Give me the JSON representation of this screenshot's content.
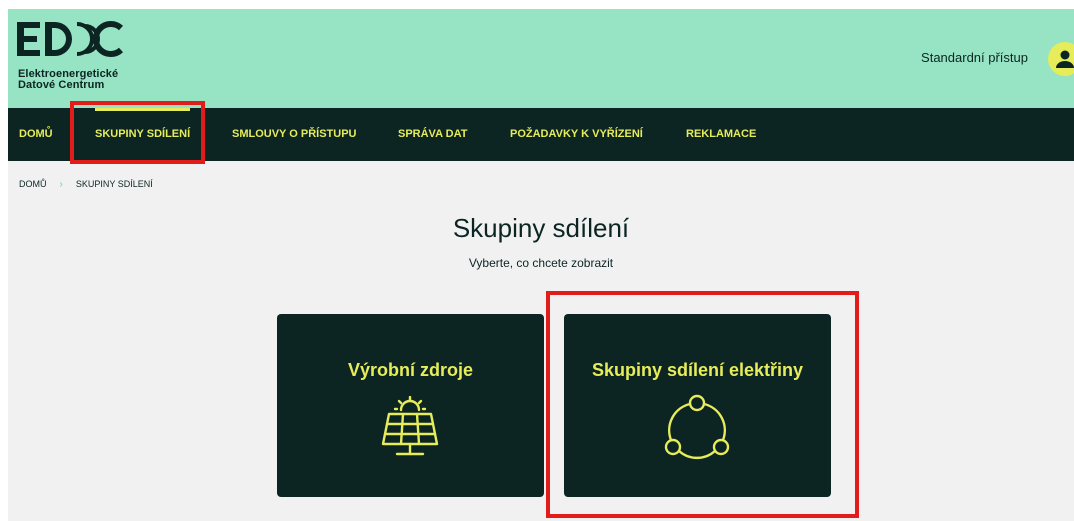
{
  "header": {
    "logo_mark": "EDC",
    "logo_line1": "Elektroenergetické",
    "logo_line2": "Datové Centrum",
    "access_label": "Standardní přístup",
    "avatar_icon": "user-icon"
  },
  "nav": {
    "items": [
      {
        "label": "DOMŮ"
      },
      {
        "label": "SKUPINY SDÍLENÍ",
        "active": true
      },
      {
        "label": "SMLOUVY O PŘÍSTUPU"
      },
      {
        "label": "SPRÁVA DAT"
      },
      {
        "label": "POŽADAVKY K VYŘÍZENÍ"
      },
      {
        "label": "REKLAMACE"
      }
    ]
  },
  "breadcrumb": {
    "home": "DOMŮ",
    "current": "SKUPINY SDÍLENÍ"
  },
  "page": {
    "title": "Skupiny sdílení",
    "subtitle": "Vyberte, co chcete zobrazit"
  },
  "cards": [
    {
      "title": "Výrobní zdroje",
      "icon": "solar-panel-icon"
    },
    {
      "title": "Skupiny sdílení elektřiny",
      "icon": "sharing-group-icon"
    }
  ],
  "colors": {
    "header_bg": "#96e4c4",
    "dark": "#0c2523",
    "accent": "#e6ec5a",
    "highlight": "#e21b1b"
  }
}
